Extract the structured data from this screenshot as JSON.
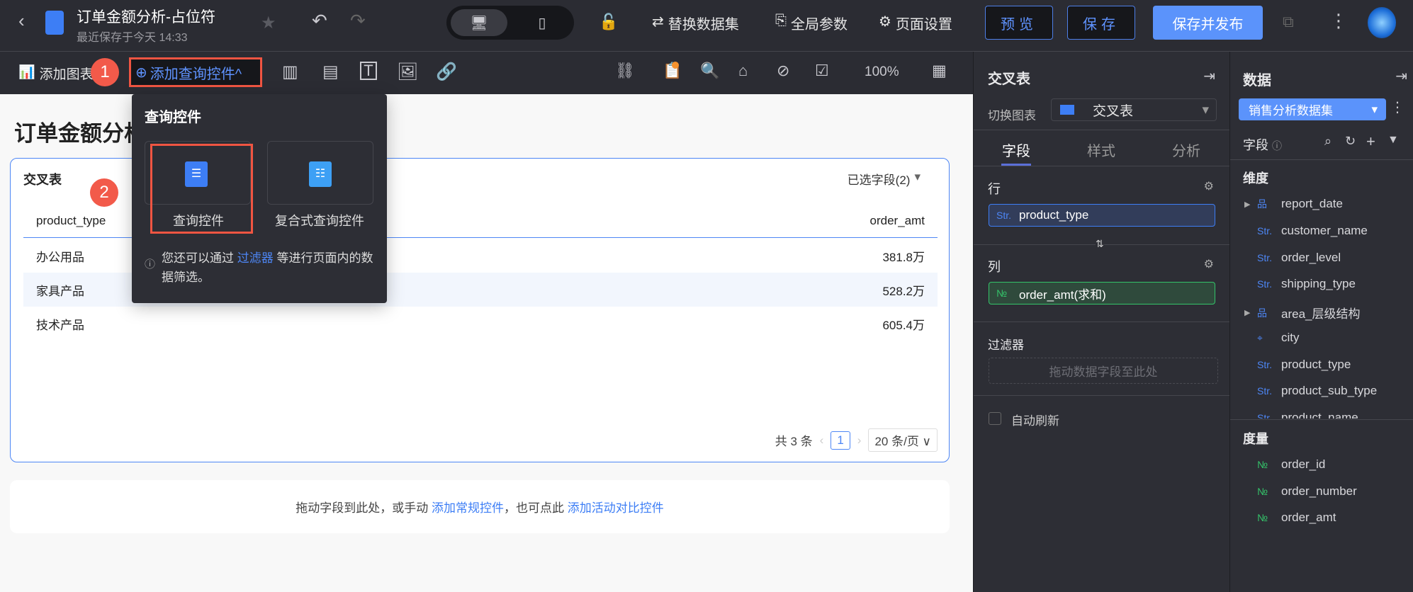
{
  "header": {
    "title": "订单金额分析-占位符",
    "subtitle": "最近保存于今天 14:33",
    "replace_dataset": "替换数据集",
    "global_params": "全局参数",
    "page_settings": "页面设置",
    "preview": "预览",
    "save": "保存",
    "save_publish": "保存并发布"
  },
  "toolbar": {
    "add_chart": "添加图表",
    "add_query": "添加查询控件^",
    "zoom": "100%"
  },
  "canvas": {
    "page_title": "订单金额分析-占位符",
    "card_title": "交叉表",
    "selected_fields": "已选字段(2)",
    "columns": [
      "product_type",
      "order_amt"
    ],
    "rows": [
      [
        "办公用品",
        "381.8万"
      ],
      [
        "家具产品",
        "528.2万"
      ],
      [
        "技术产品",
        "605.4万"
      ]
    ],
    "pagination": {
      "total": "共 3 条",
      "page": "1",
      "page_size": "20 条/页"
    },
    "drop_hint": "拖动字段到此处，或手动",
    "add_regular": "添加常规控件",
    "drop_hint2": "，也可点此",
    "add_compare": "添加活动对比控件"
  },
  "dropdown": {
    "title": "查询控件",
    "option1": "查询控件",
    "option2": "复合式查询控件",
    "tip_prefix": "您还可以通过",
    "tip_link": "过滤器",
    "tip_suffix": "等进行页面内的数据筛选。"
  },
  "badges": [
    "1",
    "2"
  ],
  "chart_panel": {
    "title": "交叉表",
    "switch_label": "切换图表",
    "chart_type": "交叉表",
    "tabs": [
      "字段",
      "样式",
      "分析"
    ],
    "row_label": "行",
    "row_field": "product_type",
    "col_label": "列",
    "col_field": "order_amt(求和)",
    "filter_label": "过滤器",
    "filter_placeholder": "拖动数据字段至此处",
    "auto_refresh": "自动刷新"
  },
  "data_panel": {
    "title": "数据",
    "dataset": "销售分析数据集",
    "fields_label": "字段",
    "dim_label": "维度",
    "dimensions": [
      "report_date",
      "customer_name",
      "order_level",
      "shipping_type",
      "area_层级结构",
      "city",
      "product_type",
      "product_sub_type",
      "product_name"
    ],
    "measure_label": "度量",
    "measures": [
      "order_id",
      "order_number",
      "order_amt"
    ],
    "type_str": "Str.",
    "type_num": "№"
  },
  "colors": {
    "accent": "#4d86f5",
    "badge": "#f25a4a",
    "highlight": "#f05542"
  }
}
